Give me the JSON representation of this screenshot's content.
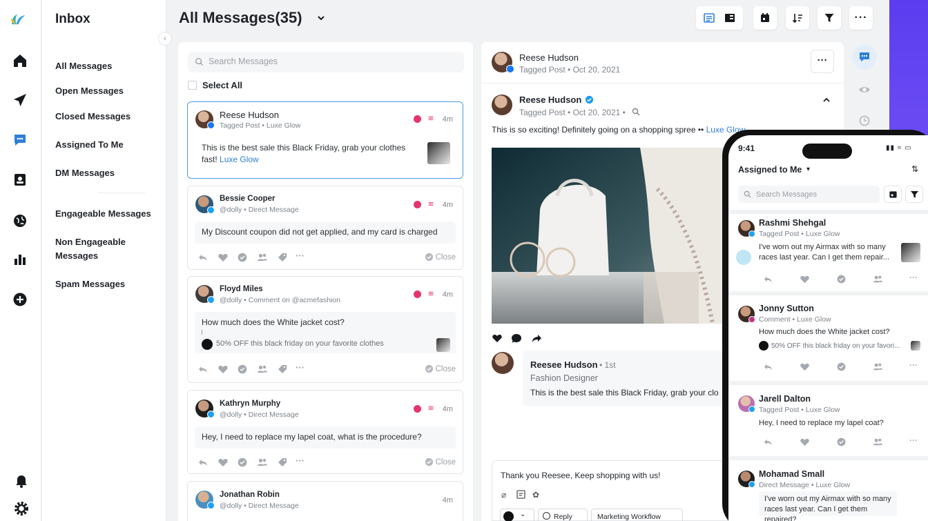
{
  "nav": {
    "title": "Inbox",
    "items": [
      "All Messages",
      "Open Messages",
      "Closed Messages",
      "Assigned To Me",
      "DM Messages",
      "Engageable Messages",
      "Non Engageable Messages",
      "Spam Messages"
    ]
  },
  "header": {
    "title": "All Messages(35)"
  },
  "list": {
    "search_placeholder": "Search Messages",
    "select_all": "Select All",
    "close_label": "Close",
    "cards": [
      {
        "name": "Reese Hudson",
        "sub": "Tagged Post • Luxe Glow",
        "time": "4m",
        "text": "This is the best sale this Black Friday, grab your clothes fast! ",
        "link": "Luxe Glow"
      },
      {
        "name": "Bessie Cooper",
        "sub": "@dolly • Direct Message",
        "time": "4m",
        "text": "My Discount coupon did not get applied, and my card is charged"
      },
      {
        "name": "Floyd Miles",
        "sub": "@dolly • Comment on @acmefashion",
        "time": "4m",
        "text": "How much does the White jacket cost?",
        "quote": "50% OFF this black friday on your favorite clothes"
      },
      {
        "name": "Kathryn Murphy",
        "sub": "@dolly • Direct Message",
        "time": "4m",
        "text": "Hey, I need to replace my lapel coat, what is the procedure?"
      },
      {
        "name": "Jonathan Robin",
        "sub": "@dolly • Direct Message",
        "time": "4m"
      }
    ]
  },
  "detail": {
    "header_name": "Reese Hudson",
    "header_sub": "Tagged Post • Oct 20, 2021",
    "post_name": "Reese Hudson",
    "post_sub": "Tagged Post • Oct 20, 2021 •",
    "post_text": "This is so exciting! Definitely going on a shopping spree •• ",
    "post_link": "Luxe Glow",
    "comment_name": "Reesee Hudson",
    "comment_degree": "• 1st",
    "comment_role": "Fashion Designer",
    "comment_text": "This is the best sale this Black Friday, grab your clo",
    "reply_text": "Thank you Reesee, Keep shopping with us!",
    "reply_btn": "Reply",
    "workflow_btn": "Marketing Workflow"
  },
  "phone": {
    "time": "9:41",
    "title": "Assigned to Me",
    "search_placeholder": "Search Messages",
    "items": [
      {
        "name": "Rashmi Shehgal",
        "sub": "Tagged Post • Luxe Glow",
        "msg": "I've worn out my Airmax with so many races last year. Can I get them repair..."
      },
      {
        "name": "Jonny Sutton",
        "sub": "Comment • Luxe Glow",
        "msg": "How much does the White jacket cost?",
        "quote": "50% OFF this black friday on your favori..."
      },
      {
        "name": "Jarell Dalton",
        "sub": "Tagged Post • Luxe Glow",
        "msg": "Hey, I need to replace my lapel coat?"
      },
      {
        "name": "Mohamad Small",
        "sub": "Direct Message • Luxe Glow",
        "msg": "I've worn out my Airmax with so many races last year. Can I get them repaired?"
      }
    ]
  },
  "colors": {
    "accent": "#2f7fd8",
    "selected_border": "#4b9be8",
    "flag": "#e4356b",
    "brand_purple": "#5b3df0"
  }
}
